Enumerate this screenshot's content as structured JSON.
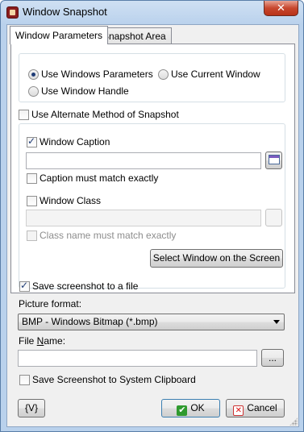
{
  "window": {
    "title": "Window Snapshot",
    "close_glyph": "✕"
  },
  "tabs": [
    {
      "label": "Window Parameters",
      "active": true
    },
    {
      "label": "Snapshot Area",
      "active": false
    }
  ],
  "mode": {
    "options": [
      {
        "label": "Use Windows Parameters",
        "checked": true
      },
      {
        "label": "Use Current Window",
        "checked": false
      },
      {
        "label": "Use Window Handle",
        "checked": false
      }
    ]
  },
  "alternate_method": {
    "label": "Use Alternate Method of Snapshot",
    "checked": false
  },
  "caption": {
    "label": "Window Caption",
    "checked": true,
    "value": "",
    "match_exact_label": "Caption must match exactly",
    "match_exact_checked": false
  },
  "class": {
    "label": "Window Class",
    "checked": false,
    "value": "",
    "match_exact_label": "Class name must match exactly",
    "match_exact_checked": false
  },
  "select_window_button": "Select Window on the Screen",
  "save_to_file": {
    "label": "Save screenshot to a file",
    "checked": true
  },
  "picture_format": {
    "label": "Picture format:",
    "selected": "BMP - Windows Bitmap (*.bmp)"
  },
  "file_name": {
    "label_prefix": "File ",
    "label_accel": "N",
    "label_suffix": "ame:",
    "value": "",
    "browse_label": "..."
  },
  "clipboard": {
    "label": "Save Screenshot to System Clipboard",
    "checked": false
  },
  "footer": {
    "variables_label": "{V}",
    "ok_label": "OK",
    "cancel_label": "Cancel",
    "ok_icon_glyph": "✔",
    "cancel_icon_glyph": "✕"
  }
}
